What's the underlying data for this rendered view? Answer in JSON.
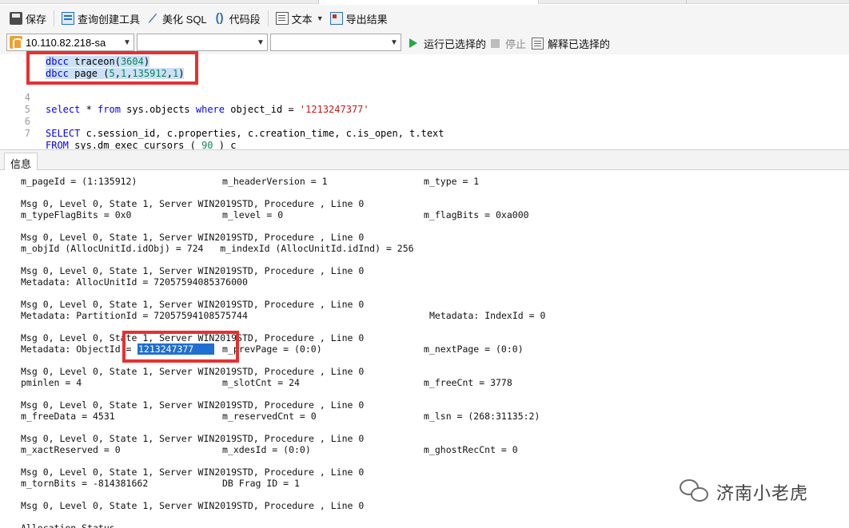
{
  "toolbar": {
    "save": "保存",
    "query_builder": "查询创建工具",
    "beautify": "美化 SQL",
    "code_snippet": "代码段",
    "text_mode": "文本",
    "export": "导出结果"
  },
  "connection": {
    "server": "10.110.82.218-sa",
    "database": "",
    "schema": "",
    "run_selected": "运行已选择的",
    "stop": "停止",
    "explain_selected": "解释已选择的"
  },
  "editor": {
    "lines": [
      {
        "num": "",
        "tokens": [
          {
            "t": "dbcc",
            "c": "kw sel"
          },
          {
            "t": " traceon(",
            "c": "sel"
          },
          {
            "t": "3604",
            "c": "num sel"
          },
          {
            "t": ")",
            "c": "sel"
          }
        ]
      },
      {
        "num": "",
        "tokens": [
          {
            "t": "dbcc",
            "c": "kw sel"
          },
          {
            "t": " page (",
            "c": "sel"
          },
          {
            "t": "5",
            "c": "num sel"
          },
          {
            "t": ",",
            "c": "sel"
          },
          {
            "t": "1",
            "c": "num sel"
          },
          {
            "t": ",",
            "c": "sel"
          },
          {
            "t": "135912",
            "c": "num sel"
          },
          {
            "t": ",",
            "c": "sel"
          },
          {
            "t": "1",
            "c": "num sel"
          },
          {
            "t": ")",
            "c": "sel"
          }
        ]
      },
      {
        "num": "",
        "tokens": []
      },
      {
        "num": "4",
        "tokens": []
      },
      {
        "num": "5",
        "tokens": [
          {
            "t": "select",
            "c": "kw"
          },
          {
            "t": " * ",
            "c": ""
          },
          {
            "t": "from",
            "c": "kw"
          },
          {
            "t": " sys.objects ",
            "c": ""
          },
          {
            "t": "where",
            "c": "kw"
          },
          {
            "t": " object_id = ",
            "c": ""
          },
          {
            "t": "'1213247377'",
            "c": "str"
          }
        ]
      },
      {
        "num": "6",
        "tokens": []
      },
      {
        "num": "7",
        "tokens": [
          {
            "t": "SELECT",
            "c": "kw"
          },
          {
            "t": " c.session_id, c.properties, c.creation_time, c.is_open, t.text",
            "c": ""
          }
        ]
      },
      {
        "num": "",
        "tokens": [
          {
            "t": "FROM",
            "c": "kw"
          },
          {
            "t": " sys.dm_exec_cursors ( ",
            "c": ""
          },
          {
            "t": "90",
            "c": "num"
          },
          {
            "t": " ) c",
            "c": ""
          }
        ]
      }
    ]
  },
  "results": {
    "tab_label": "信息",
    "lines": [
      {
        "segs": [
          {
            "col": 0,
            "t": "m_pageId = (1:135912)"
          },
          {
            "col": 1,
            "t": "m_headerVersion = 1"
          },
          {
            "col": 2,
            "t": "m_type = 1"
          }
        ]
      },
      {
        "segs": []
      },
      {
        "segs": [
          {
            "col": 0,
            "t": "Msg 0, Level 0, State 1, Server WIN2019STD, Procedure , Line 0"
          }
        ]
      },
      {
        "segs": [
          {
            "col": 0,
            "t": "m_typeFlagBits = 0x0"
          },
          {
            "col": 1,
            "t": "m_level = 0"
          },
          {
            "col": 2,
            "t": "m_flagBits = 0xa000"
          }
        ]
      },
      {
        "segs": []
      },
      {
        "segs": [
          {
            "col": 0,
            "t": "Msg 0, Level 0, State 1, Server WIN2019STD, Procedure , Line 0"
          }
        ]
      },
      {
        "segs": [
          {
            "col": 0,
            "t": "m_objId (AllocUnitId.idObj) = 724   m_indexId (AllocUnitId.idInd) = 256"
          }
        ]
      },
      {
        "segs": []
      },
      {
        "segs": [
          {
            "col": 0,
            "t": "Msg 0, Level 0, State 1, Server WIN2019STD, Procedure , Line 0"
          }
        ]
      },
      {
        "segs": [
          {
            "col": 0,
            "t": "Metadata: AllocUnitId = 72057594085376000"
          }
        ]
      },
      {
        "segs": []
      },
      {
        "segs": [
          {
            "col": 0,
            "t": "Msg 0, Level 0, State 1, Server WIN2019STD, Procedure , Line 0"
          }
        ]
      },
      {
        "segs": [
          {
            "col": 0,
            "t": "Metadata: PartitionId = 72057594108575744"
          },
          {
            "col": 3,
            "t": "Metadata: IndexId = 0"
          }
        ]
      },
      {
        "segs": []
      },
      {
        "segs": [
          {
            "col": 0,
            "t": "Msg 0, Level 0, State 1, Server WIN2019STD, Procedure , Line 0"
          }
        ]
      },
      {
        "segs": [
          {
            "col": 0,
            "t": "Metadata: ObjectId = "
          },
          {
            "col": 4,
            "t": "1213247377",
            "hl": true
          },
          {
            "col": 1,
            "t": "m_prevPage = (0:0)"
          },
          {
            "col": 2,
            "t": "m_nextPage = (0:0)"
          }
        ]
      },
      {
        "segs": []
      },
      {
        "segs": [
          {
            "col": 0,
            "t": "Msg 0, Level 0, State 1, Server WIN2019STD, Procedure , Line 0"
          }
        ]
      },
      {
        "segs": [
          {
            "col": 0,
            "t": "pminlen = 4"
          },
          {
            "col": 1,
            "t": "m_slotCnt = 24"
          },
          {
            "col": 2,
            "t": "m_freeCnt = 3778"
          }
        ]
      },
      {
        "segs": []
      },
      {
        "segs": [
          {
            "col": 0,
            "t": "Msg 0, Level 0, State 1, Server WIN2019STD, Procedure , Line 0"
          }
        ]
      },
      {
        "segs": [
          {
            "col": 0,
            "t": "m_freeData = 4531"
          },
          {
            "col": 1,
            "t": "m_reservedCnt = 0"
          },
          {
            "col": 2,
            "t": "m_lsn = (268:31135:2)"
          }
        ]
      },
      {
        "segs": []
      },
      {
        "segs": [
          {
            "col": 0,
            "t": "Msg 0, Level 0, State 1, Server WIN2019STD, Procedure , Line 0"
          }
        ]
      },
      {
        "segs": [
          {
            "col": 0,
            "t": "m_xactReserved = 0"
          },
          {
            "col": 1,
            "t": "m_xdesId = (0:0)"
          },
          {
            "col": 2,
            "t": "m_ghostRecCnt = 0"
          }
        ]
      },
      {
        "segs": []
      },
      {
        "segs": [
          {
            "col": 0,
            "t": "Msg 0, Level 0, State 1, Server WIN2019STD, Procedure , Line 0"
          }
        ]
      },
      {
        "segs": [
          {
            "col": 0,
            "t": "m_tornBits = -814381662"
          },
          {
            "col": 1,
            "t": "DB Frag ID = 1"
          }
        ]
      },
      {
        "segs": []
      },
      {
        "segs": [
          {
            "col": 0,
            "t": "Msg 0, Level 0, State 1, Server WIN2019STD, Procedure , Line 0"
          }
        ]
      },
      {
        "segs": []
      },
      {
        "segs": [
          {
            "col": 0,
            "t": "Allocation Status"
          }
        ]
      }
    ]
  },
  "watermark": {
    "text": "济南小老虎"
  }
}
